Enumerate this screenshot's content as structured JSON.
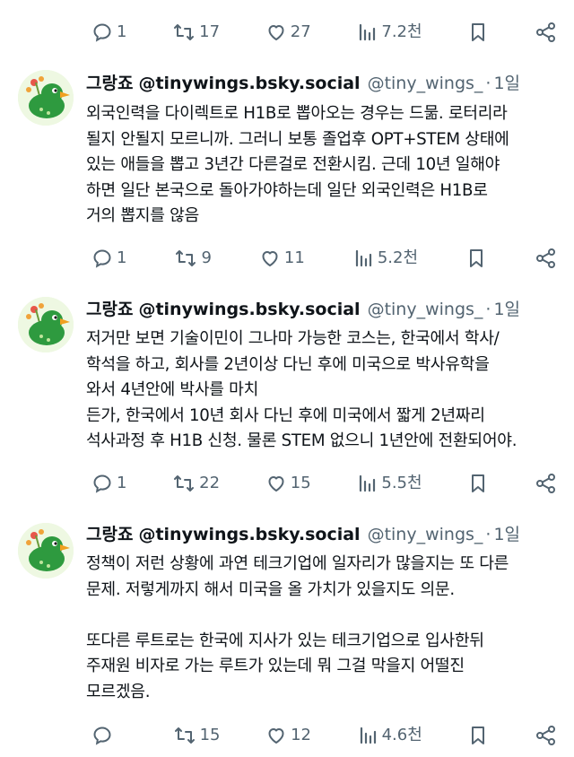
{
  "top_actions": {
    "reply_count": "1",
    "repost_count": "17",
    "like_count": "27",
    "views_count": "7.2천"
  },
  "tweets": [
    {
      "name": "그랑죠",
      "display_handle": "@tinywings.bsky.social",
      "handle": "@tiny_wings_",
      "dot": "·",
      "time": "1일",
      "lines": [
        "외국인력을 다이렉트로 H1B로 뽑아오는 경우는 드묾. 로터리라",
        "될지 안될지 모르니까. 그러니 보통 졸업후 OPT+STEM 상태에",
        "있는 애들을 뽑고 3년간 다른걸로 전환시킴. 근데 10년 일해야",
        "하면 일단 본국으로 돌아가야하는데 일단 외국인력은 H1B로",
        "거의 뽑지를 않음"
      ],
      "actions": {
        "reply_count": "1",
        "repost_count": "9",
        "like_count": "11",
        "views_count": "5.2천"
      }
    },
    {
      "name": "그랑죠",
      "display_handle": "@tinywings.bsky.social",
      "handle": "@tiny_wings_",
      "dot": "·",
      "time": "1일",
      "lines": [
        "저거만 보면 기술이민이 그나마 가능한 코스는, 한국에서 학사/",
        "학석을 하고, 회사를 2년이상 다닌 후에 미국으로 박사유학을",
        "와서 4년안에 박사를 마치",
        "든가, 한국에서 10년 회사 다닌 후에 미국에서 짧게 2년짜리",
        "석사과정 후 H1B 신청. 물론 STEM 없으니 1년안에 전환되어야."
      ],
      "actions": {
        "reply_count": "1",
        "repost_count": "22",
        "like_count": "15",
        "views_count": "5.5천"
      }
    },
    {
      "name": "그랑죠",
      "display_handle": "@tinywings.bsky.social",
      "handle": "@tiny_wings_",
      "dot": "·",
      "time": "1일",
      "lines": [
        "정책이 저런 상황에 과연 테크기업에 일자리가 많을지는 또 다른",
        "문제. 저렇게까지 해서 미국을 올 가치가 있을지도 의문.",
        "",
        "또다른 루트로는 한국에 지사가 있는 테크기업으로 입사한뒤",
        "주재원 비자로 가는 루트가 있는데 뭐 그걸 막을지 어떨진",
        "모르겠음."
      ],
      "actions": {
        "reply_count": "",
        "repost_count": "15",
        "like_count": "12",
        "views_count": "4.6천"
      }
    }
  ],
  "icons": {
    "reply": "reply-icon",
    "repost": "repost-icon",
    "like": "heart-icon",
    "views": "views-icon",
    "bookmark": "bookmark-icon",
    "share": "share-icon"
  },
  "colors": {
    "text": "#0f1419",
    "muted": "#536471",
    "background": "#ffffff"
  }
}
